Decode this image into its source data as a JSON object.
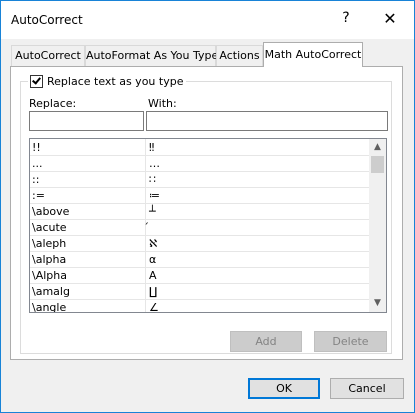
{
  "window": {
    "title": "AutoCorrect",
    "help_glyph": "?",
    "close_glyph": "✕"
  },
  "tabs": [
    {
      "label": "AutoCorrect",
      "active": false
    },
    {
      "label": "AutoFormat As You Type",
      "active": false
    },
    {
      "label": "Actions",
      "active": false
    },
    {
      "label": "Math AutoCorrect",
      "active": true
    }
  ],
  "options": {
    "replace_as_you_type_label": "Replace text as you type",
    "replace_as_you_type_checked": true
  },
  "fields": {
    "replace_label": "Replace:",
    "replace_value": "",
    "with_label": "With:",
    "with_value": ""
  },
  "entries": [
    {
      "replace": "!!",
      "with": "‼"
    },
    {
      "replace": "...",
      "with": "…"
    },
    {
      "replace": "::",
      "with": "∷"
    },
    {
      "replace": ":=",
      "with": "≔"
    },
    {
      "replace": "\\above",
      "with": "┴"
    },
    {
      "replace": "\\acute",
      "with": "́"
    },
    {
      "replace": "\\aleph",
      "with": "ℵ"
    },
    {
      "replace": "\\alpha",
      "with": "α"
    },
    {
      "replace": "\\Alpha",
      "with": "Α"
    },
    {
      "replace": "\\amalg",
      "with": "∐"
    },
    {
      "replace": "\\angle",
      "with": "∠"
    }
  ],
  "scrollbar": {
    "up_glyph": "▲",
    "down_glyph": "▼"
  },
  "actions": {
    "add_label": "Add",
    "delete_label": "Delete"
  },
  "footer": {
    "ok_label": "OK",
    "cancel_label": "Cancel"
  },
  "colors": {
    "window_border": "#1883d7",
    "default_button_border": "#0078d7",
    "dialog_background": "#f0f0f0"
  }
}
